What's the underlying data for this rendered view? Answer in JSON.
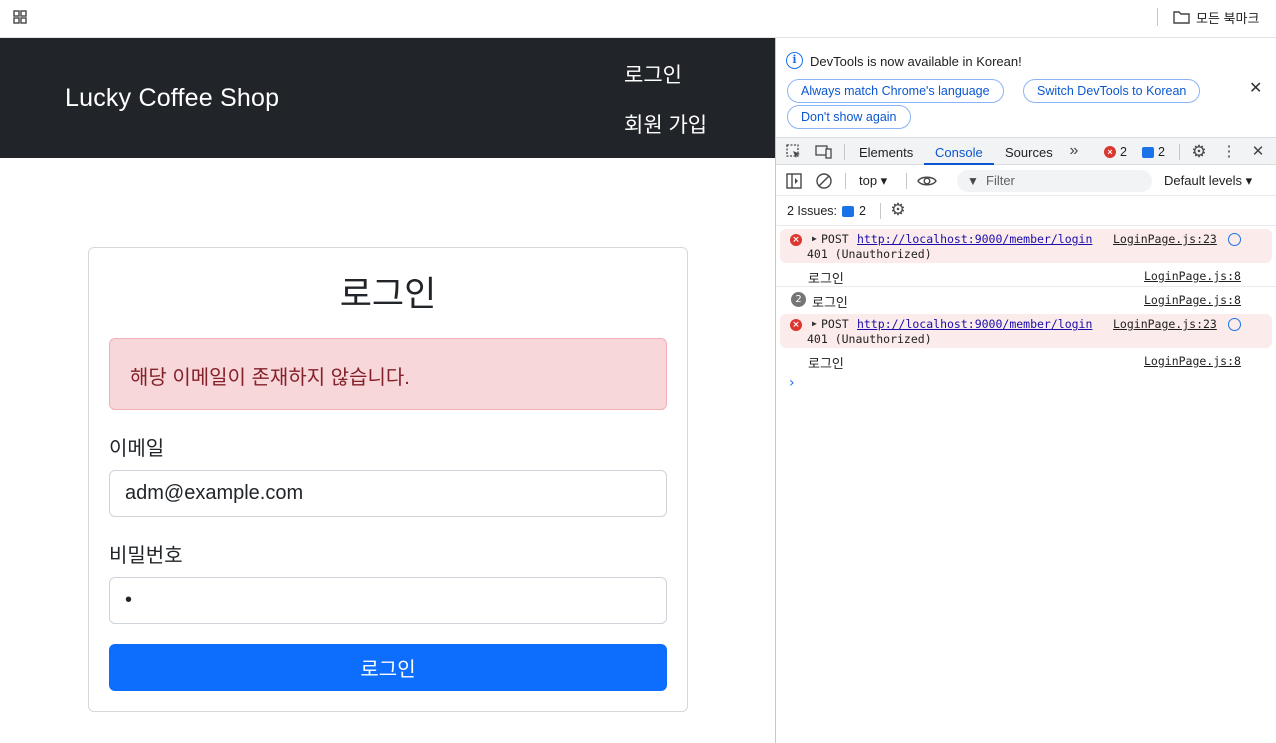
{
  "bookmarks": {
    "all_label": "모든 북마크"
  },
  "site": {
    "brand": "Lucky Coffee Shop",
    "nav": {
      "login": "로그인",
      "signup": "회원 가입"
    }
  },
  "login_form": {
    "title": "로그인",
    "alert": "해당 이메일이 존재하지 않습니다.",
    "email_label": "이메일",
    "email_value": "adm@example.com",
    "password_label": "비밀번호",
    "password_value": "•",
    "submit_label": "로그인"
  },
  "devtools": {
    "info": {
      "text": "DevTools is now available in Korean!",
      "btn_match": "Always match Chrome's language",
      "btn_switch": "Switch DevTools to Korean",
      "btn_dont": "Don't show again"
    },
    "tabs": {
      "elements": "Elements",
      "console": "Console",
      "sources": "Sources"
    },
    "error_count": "2",
    "message_count": "2",
    "toolbar": {
      "context": "top ▾",
      "filter_placeholder": "Filter",
      "levels": "Default levels ▾"
    },
    "issues": {
      "label": "2 Issues:",
      "count": "2"
    },
    "log": [
      {
        "method": "POST",
        "url": "http://localhost:9000/member/login",
        "status": "401 (Unauthorized)",
        "source": "LoginPage.js:23"
      },
      {
        "message": "로그인",
        "source": "LoginPage.js:8"
      },
      {
        "repeat": "2",
        "message": "로그인",
        "source": "LoginPage.js:8"
      },
      {
        "method": "POST",
        "url": "http://localhost:9000/member/login",
        "status": "401 (Unauthorized)",
        "source": "LoginPage.js:23"
      },
      {
        "message": "로그인",
        "source": "LoginPage.js:8"
      }
    ],
    "prompt": "›"
  },
  "colors": {
    "navbar": "#212529",
    "primary": "#0d6efd",
    "alert_bg": "#f8d7da",
    "alert_text": "#842029",
    "devtools_accent": "#0b57d0",
    "error": "#dc362e"
  }
}
